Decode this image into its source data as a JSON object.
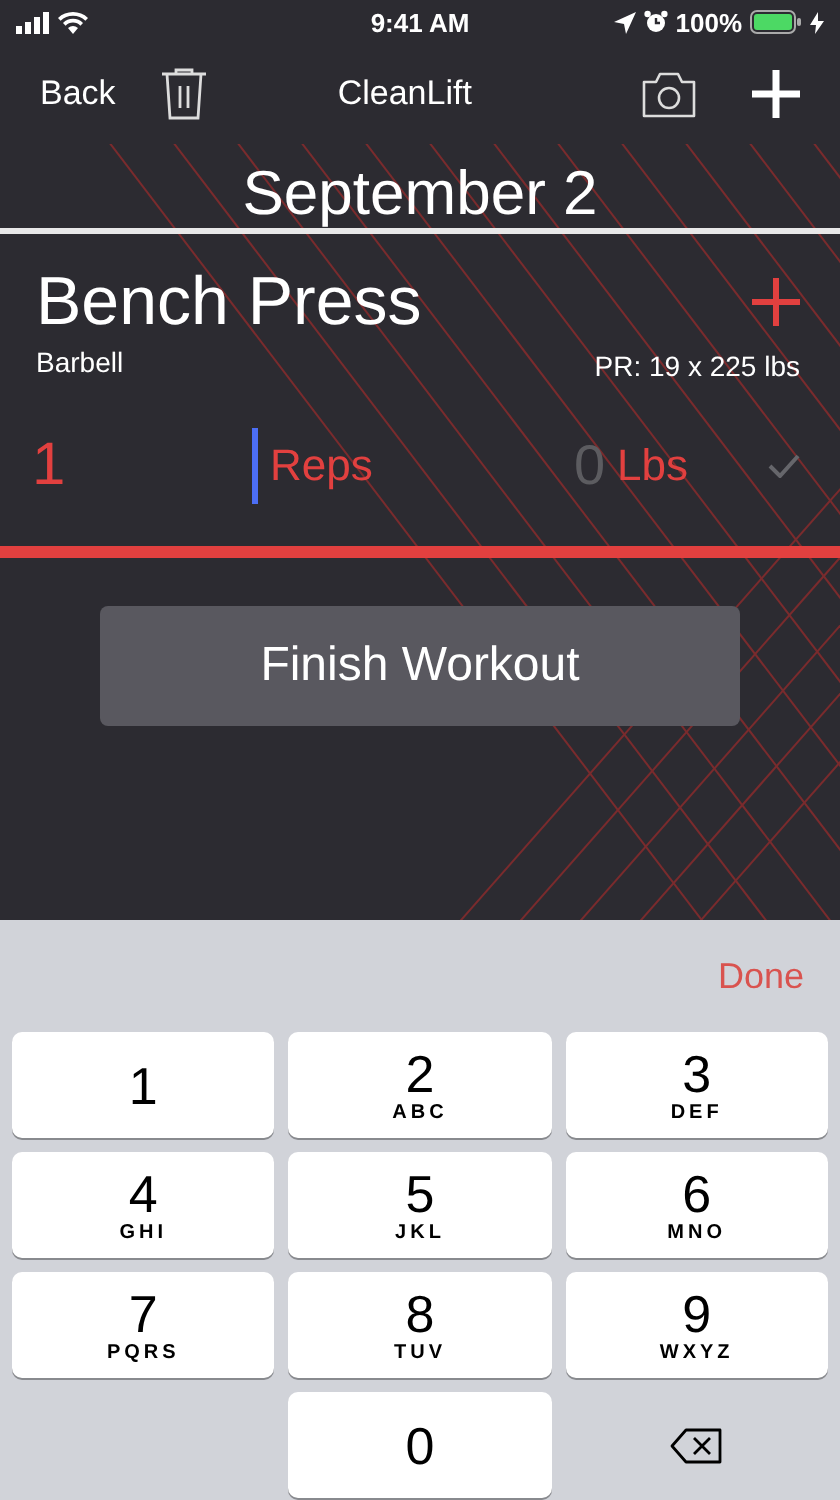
{
  "status_bar": {
    "time": "9:41 AM",
    "battery": "100%"
  },
  "nav": {
    "back": "Back",
    "title": "CleanLift"
  },
  "date": "September 2",
  "exercise": {
    "name": "Bench Press",
    "equipment": "Barbell",
    "pr": "PR: 19 x 225 lbs"
  },
  "set": {
    "reps": {
      "value": "1",
      "label": "Reps",
      "focused": true
    },
    "weight": {
      "placeholder": "0",
      "label": "Lbs"
    },
    "completed": false
  },
  "finish_button": "Finish Workout",
  "keyboard": {
    "done": "Done",
    "keys": [
      {
        "kind": "digit",
        "digit": "1"
      },
      {
        "kind": "digit",
        "digit": "2",
        "letters": "ABC"
      },
      {
        "kind": "digit",
        "digit": "3",
        "letters": "DEF"
      },
      {
        "kind": "digit",
        "digit": "4",
        "letters": "GHI"
      },
      {
        "kind": "digit",
        "digit": "5",
        "letters": "JKL"
      },
      {
        "kind": "digit",
        "digit": "6",
        "letters": "MNO"
      },
      {
        "kind": "digit",
        "digit": "7",
        "letters": "PQRS"
      },
      {
        "kind": "digit",
        "digit": "8",
        "letters": "TUV"
      },
      {
        "kind": "digit",
        "digit": "9",
        "letters": "WXYZ"
      },
      {
        "kind": "blank"
      },
      {
        "kind": "digit",
        "digit": "0"
      },
      {
        "kind": "delete"
      }
    ]
  }
}
